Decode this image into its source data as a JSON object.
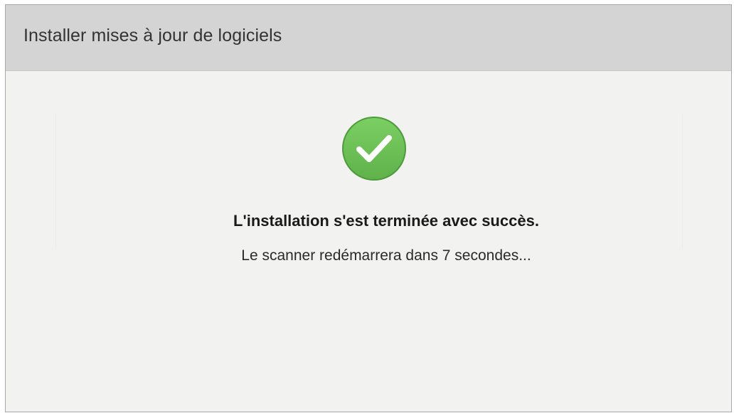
{
  "dialog": {
    "title": "Installer mises à jour de logiciels"
  },
  "status": {
    "icon": "success-check-icon",
    "icon_color": "#6fc15a",
    "message": "L'installation s'est terminée avec succès.",
    "detail": "Le scanner redémarrera dans 7 secondes..."
  }
}
